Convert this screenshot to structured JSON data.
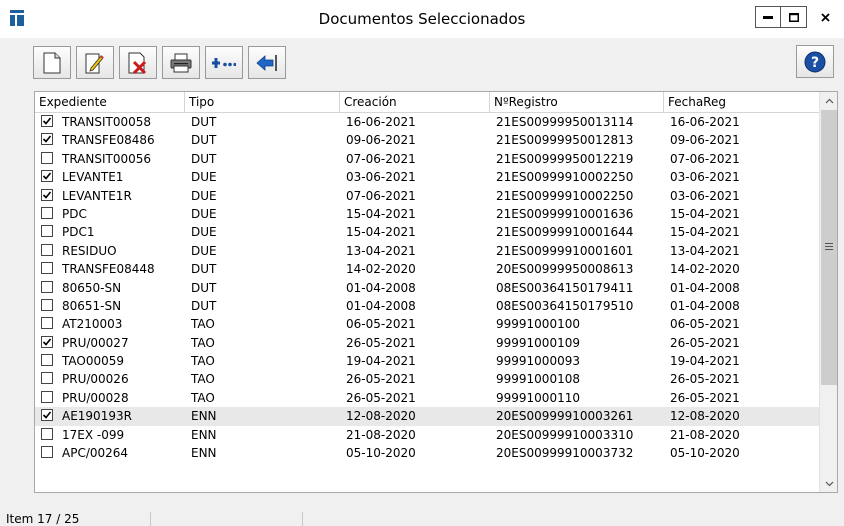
{
  "window": {
    "title": "Documentos Seleccionados",
    "min_glyph": "▬",
    "max_glyph": "□",
    "close_glyph": "x"
  },
  "toolbar": {
    "buttons": [
      {
        "icon": "new-document-icon"
      },
      {
        "icon": "edit-document-icon"
      },
      {
        "icon": "delete-document-icon"
      },
      {
        "icon": "print-icon"
      },
      {
        "icon": "add-more-icon"
      },
      {
        "icon": "back-arrow-icon"
      }
    ],
    "help_icon": "help-icon"
  },
  "table": {
    "columns": [
      "Expediente",
      "Tipo",
      "Creación",
      "NºRegistro",
      "FechaReg"
    ],
    "rows": [
      {
        "checked": true,
        "expediente": "TRANSIT00058",
        "tipo": "DUT",
        "creacion": "16-06-2021",
        "registro": "21ES00999950013114",
        "fechareg": "16-06-2021"
      },
      {
        "checked": true,
        "expediente": "TRANSFE08486",
        "tipo": "DUT",
        "creacion": "09-06-2021",
        "registro": "21ES00999950012813",
        "fechareg": "09-06-2021"
      },
      {
        "checked": false,
        "expediente": "TRANSIT00056",
        "tipo": "DUT",
        "creacion": "07-06-2021",
        "registro": "21ES00999950012219",
        "fechareg": "07-06-2021"
      },
      {
        "checked": true,
        "expediente": "LEVANTE1",
        "tipo": "DUE",
        "creacion": "03-06-2021",
        "registro": "21ES00999910002250",
        "fechareg": "03-06-2021"
      },
      {
        "checked": true,
        "expediente": "LEVANTE1R",
        "tipo": "DUE",
        "creacion": "07-06-2021",
        "registro": "21ES00999910002250",
        "fechareg": "03-06-2021"
      },
      {
        "checked": false,
        "expediente": "PDC",
        "tipo": "DUE",
        "creacion": "15-04-2021",
        "registro": "21ES00999910001636",
        "fechareg": "15-04-2021"
      },
      {
        "checked": false,
        "expediente": "PDC1",
        "tipo": "DUE",
        "creacion": "15-04-2021",
        "registro": "21ES00999910001644",
        "fechareg": "15-04-2021"
      },
      {
        "checked": false,
        "expediente": "RESIDUO",
        "tipo": "DUE",
        "creacion": "13-04-2021",
        "registro": "21ES00999910001601",
        "fechareg": "13-04-2021"
      },
      {
        "checked": false,
        "expediente": "TRANSFE08448",
        "tipo": "DUT",
        "creacion": "14-02-2020",
        "registro": "20ES00999950008613",
        "fechareg": "14-02-2020"
      },
      {
        "checked": false,
        "expediente": "80650-SN",
        "tipo": "DUT",
        "creacion": "01-04-2008",
        "registro": "08ES00364150179411",
        "fechareg": "01-04-2008"
      },
      {
        "checked": false,
        "expediente": "80651-SN",
        "tipo": "DUT",
        "creacion": "01-04-2008",
        "registro": "08ES00364150179510",
        "fechareg": "01-04-2008"
      },
      {
        "checked": false,
        "expediente": "AT210003",
        "tipo": "TAO",
        "creacion": "06-05-2021",
        "registro": "99991000100",
        "fechareg": "06-05-2021"
      },
      {
        "checked": true,
        "expediente": "PRU/00027",
        "tipo": "TAO",
        "creacion": "26-05-2021",
        "registro": "99991000109",
        "fechareg": "26-05-2021"
      },
      {
        "checked": false,
        "expediente": "TAO00059",
        "tipo": "TAO",
        "creacion": "19-04-2021",
        "registro": "99991000093",
        "fechareg": "19-04-2021"
      },
      {
        "checked": false,
        "expediente": "PRU/00026",
        "tipo": "TAO",
        "creacion": "26-05-2021",
        "registro": "99991000108",
        "fechareg": "26-05-2021"
      },
      {
        "checked": false,
        "expediente": "PRU/00028",
        "tipo": "TAO",
        "creacion": "26-05-2021",
        "registro": "99991000110",
        "fechareg": "26-05-2021"
      },
      {
        "checked": true,
        "expediente": "AE190193R",
        "tipo": "ENN",
        "creacion": "12-08-2020",
        "registro": "20ES00999910003261",
        "fechareg": "12-08-2020",
        "selected": true
      },
      {
        "checked": false,
        "expediente": "17EX -099",
        "tipo": "ENN",
        "creacion": "21-08-2020",
        "registro": "20ES00999910003310",
        "fechareg": "21-08-2020"
      },
      {
        "checked": false,
        "expediente": "APC/00264",
        "tipo": "ENN",
        "creacion": "05-10-2020",
        "registro": "20ES00999910003732",
        "fechareg": "05-10-2020"
      }
    ]
  },
  "status": {
    "item_text": "Item 17 / 25"
  },
  "colors": {
    "title_icon": "#1e5f9e",
    "accent_blue": "#1a4fa0",
    "selected_row": "#e8e8e8"
  }
}
